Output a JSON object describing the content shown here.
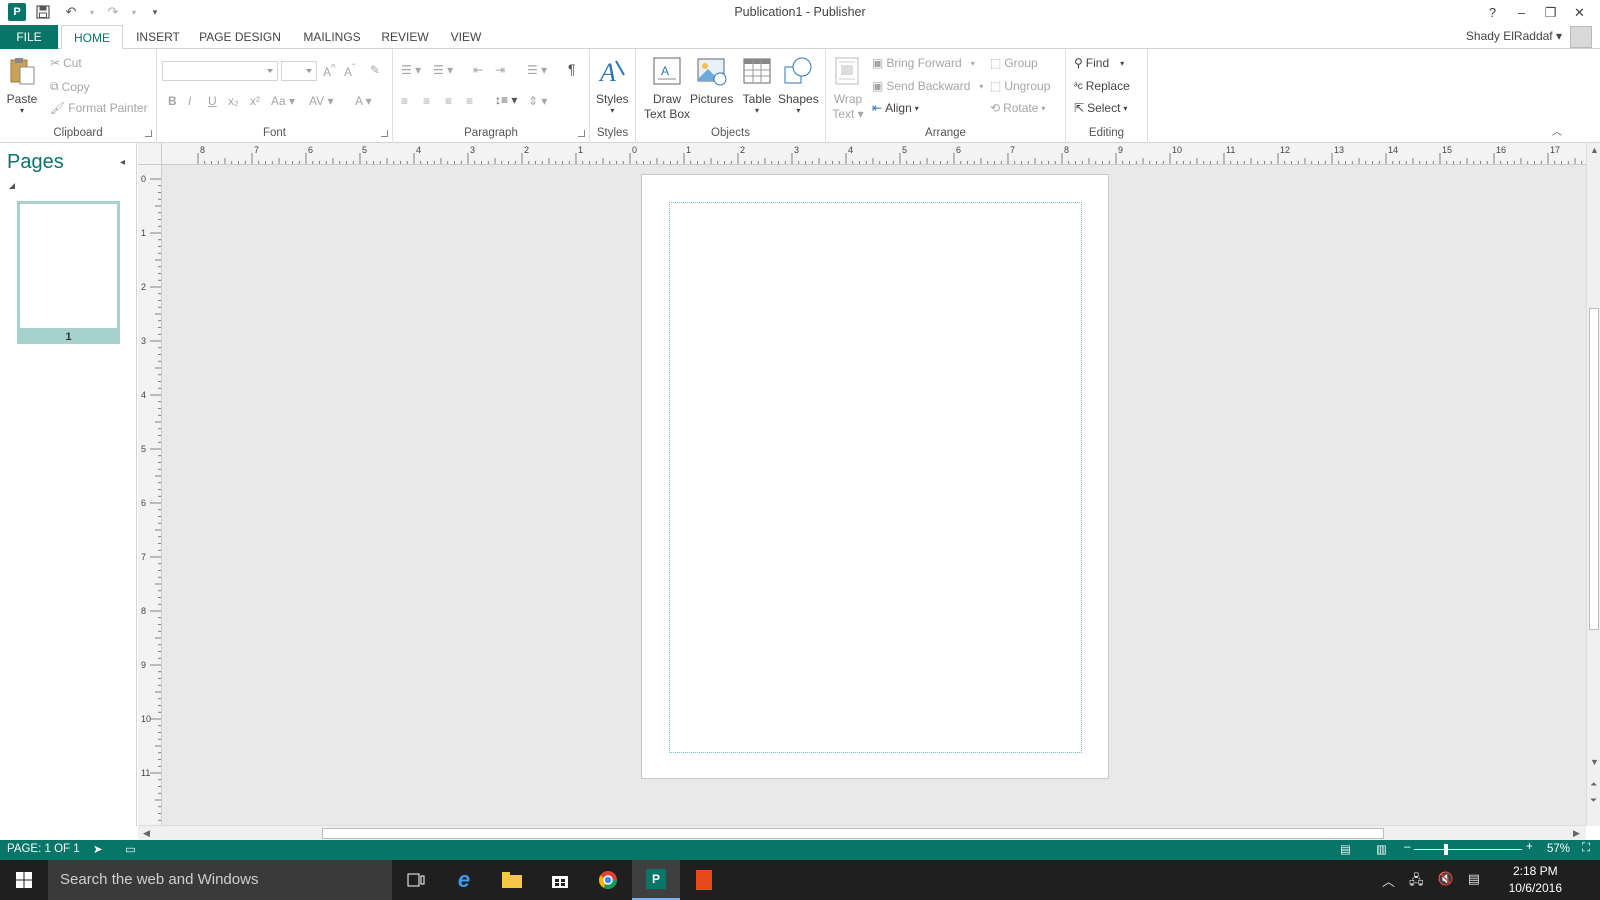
{
  "app": {
    "title": "Publication1 - Publisher",
    "user_name": "Shady ElRaddaf",
    "help": "?"
  },
  "tabs": [
    {
      "label": "FILE"
    },
    {
      "label": "HOME"
    },
    {
      "label": "INSERT"
    },
    {
      "label": "PAGE DESIGN"
    },
    {
      "label": "MAILINGS"
    },
    {
      "label": "REVIEW"
    },
    {
      "label": "VIEW"
    }
  ],
  "ribbon": {
    "clipboard": {
      "label": "Clipboard",
      "paste": "Paste",
      "cut": "Cut",
      "copy": "Copy",
      "format_painter": "Format Painter"
    },
    "font": {
      "label": "Font"
    },
    "paragraph": {
      "label": "Paragraph"
    },
    "styles": {
      "label": "Styles",
      "button": "Styles"
    },
    "objects": {
      "label": "Objects",
      "draw_text_box_1": "Draw",
      "draw_text_box_2": "Text Box",
      "pictures": "Pictures",
      "table": "Table",
      "shapes": "Shapes"
    },
    "arrange": {
      "label": "Arrange",
      "wrap_1": "Wrap",
      "wrap_2": "Text",
      "bring_forward": "Bring Forward",
      "send_backward": "Send Backward",
      "align": "Align",
      "group": "Group",
      "ungroup": "Ungroup",
      "rotate": "Rotate"
    },
    "editing": {
      "label": "Editing",
      "find": "Find",
      "replace": "Replace",
      "select": "Select"
    }
  },
  "pages_pane": {
    "title": "Pages",
    "thumbnails": [
      {
        "number": "1"
      }
    ]
  },
  "rulers": {
    "horizontal": [
      "8",
      "7",
      "6",
      "5",
      "4",
      "3",
      "2",
      "1",
      "0",
      "1",
      "2",
      "3",
      "4",
      "5",
      "6",
      "7",
      "8",
      "9",
      "10",
      "11",
      "12",
      "13",
      "14",
      "15",
      "16",
      "17"
    ],
    "vertical": [
      "0",
      "1",
      "2",
      "3",
      "4",
      "5",
      "6",
      "7",
      "8",
      "9",
      "10",
      "11"
    ]
  },
  "statusbar": {
    "page_info": "PAGE: 1 OF 1",
    "zoom": "57%"
  },
  "taskbar": {
    "search_placeholder": "Search the web and Windows",
    "time": "2:18 PM",
    "date": "10/6/2016"
  }
}
